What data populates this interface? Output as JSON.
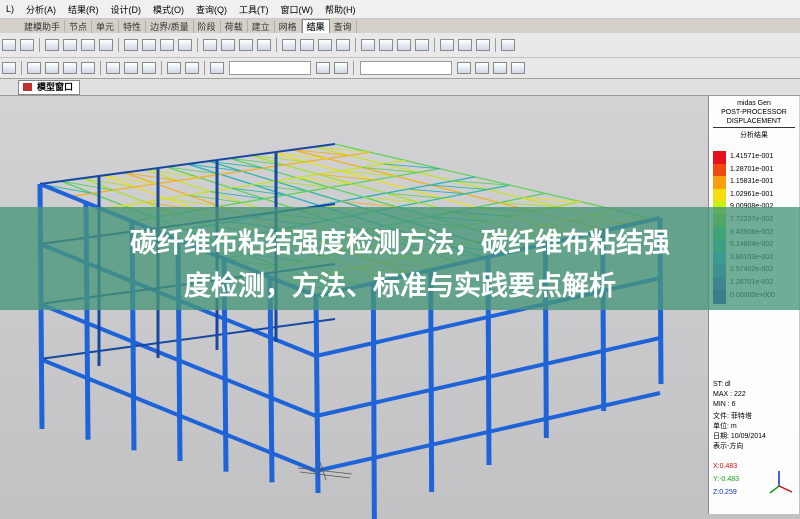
{
  "menu": [
    "L)",
    "分析(A)",
    "结果(R)",
    "设计(D)",
    "模式(O)",
    "查询(Q)",
    "工具(T)",
    "窗口(W)",
    "帮助(H)"
  ],
  "ribbon_tabs": [
    "建模助手",
    "节点",
    "单元",
    "特性",
    "边界/质量",
    "阶段",
    "荷载",
    "建立",
    "网格",
    "结果",
    "查询"
  ],
  "active_tab": "结果",
  "window_tab": "模型窗口",
  "legend": {
    "header": [
      "midas Gen",
      "POST-PROCESSOR",
      "DISPLACEMENT"
    ],
    "subtitle": "分析结果",
    "values": [
      "1.41571e-001",
      "1.28701e-001",
      "1.15831e-001",
      "1.02961e-001",
      "9.00908e-002",
      "7.72207e-002",
      "6.43506e-002",
      "5.14804e-002",
      "3.86103e-002",
      "2.57402e-002",
      "1.28701e-002",
      "0.00000e+000"
    ],
    "colors": [
      "#e8101a",
      "#f04a10",
      "#f8a010",
      "#f8dc10",
      "#c8f010",
      "#70e030",
      "#28d060",
      "#20c0a8",
      "#20a8d8",
      "#2080e0",
      "#1850d0",
      "#1030b0"
    ],
    "info": [
      "ST: dl",
      "MAX : 222",
      "MIN : 6",
      "文件: 菲特塔",
      "单位: m",
      "日期: 10/09/2014",
      "表示-方向"
    ],
    "axes": [
      "X:0.483",
      "Y:-0.483",
      "Z:0.259"
    ]
  },
  "banner": {
    "line1": "碳纤维布粘结强度检测方法，碳纤维布粘结强",
    "line2": "度检测，方法、标准与实践要点解析"
  }
}
